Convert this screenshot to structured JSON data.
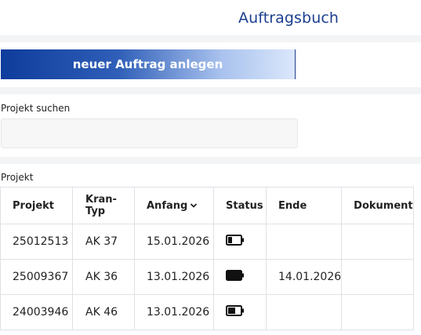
{
  "header": {
    "title": "Auftragsbuch"
  },
  "actions": {
    "new_order_label": "neuer Auftrag anlegen"
  },
  "search": {
    "label": "Projekt suchen",
    "value": "",
    "placeholder": ""
  },
  "table": {
    "label": "Projekt",
    "columns": [
      "Projekt",
      "Kran-Typ",
      "Anfang",
      "Status",
      "Ende",
      "Dokument"
    ],
    "sorted_column": "Anfang",
    "rows": [
      {
        "projekt": "25012513",
        "kran_typ": "AK 37",
        "anfang": "15.01.2026",
        "status_icon": "battery-low-icon",
        "ende": "",
        "dokument": ""
      },
      {
        "projekt": "25009367",
        "kran_typ": "AK 36",
        "anfang": "13.01.2026",
        "status_icon": "battery-full-icon",
        "ende": "14.01.2026",
        "dokument": ""
      },
      {
        "projekt": "24003946",
        "kran_typ": "AK 46",
        "anfang": "13.01.2026",
        "status_icon": "battery-half-icon",
        "ende": "",
        "dokument": ""
      }
    ]
  },
  "colors": {
    "accent": "#1b3f8f",
    "button_start": "#0e3c9c",
    "button_end": "#dbe7fb"
  }
}
